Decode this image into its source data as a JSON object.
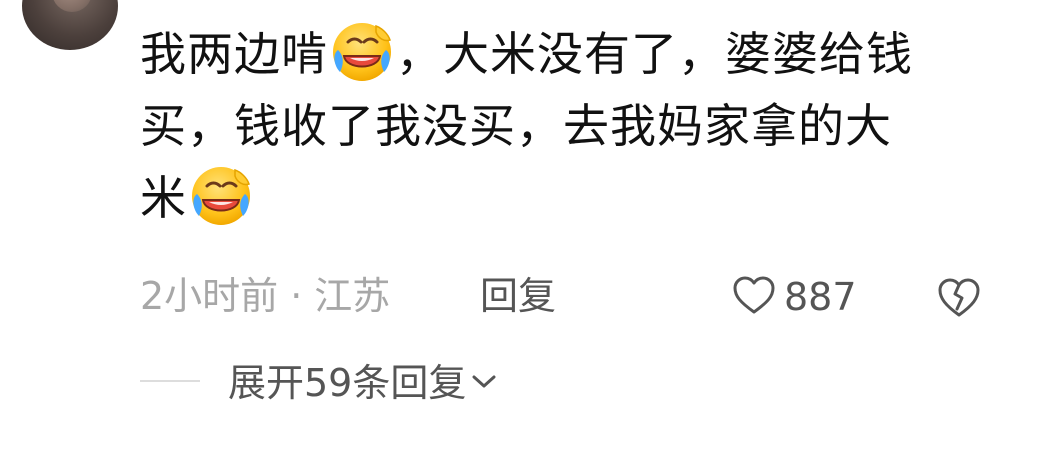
{
  "comment": {
    "line1_part1": "我两边啃",
    "line1_part2": "，大米没有了，婆婆给钱",
    "line2": "买，钱收了我没买，去我妈家拿的大",
    "line3": "米",
    "emoji_name": "tears-of-joy-icon"
  },
  "meta": {
    "time": "2小时前",
    "dot": "·",
    "location": "江苏",
    "reply_label": "回复"
  },
  "actions": {
    "like_count": "887",
    "like_icon": "heart-outline-icon",
    "dislike_icon": "broken-heart-icon"
  },
  "expand": {
    "label": "展开59条回复",
    "icon": "chevron-down-icon"
  },
  "colors": {
    "text_primary": "#111111",
    "text_meta": "#a7a7a7",
    "text_action": "#555555",
    "divider": "#dddddd"
  }
}
